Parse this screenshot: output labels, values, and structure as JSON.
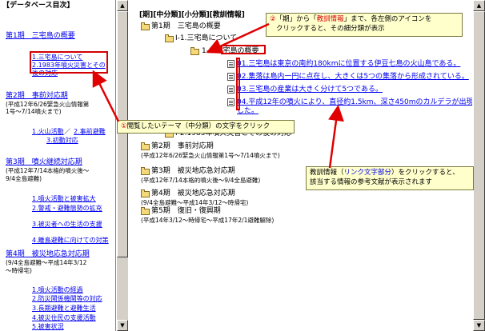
{
  "left": {
    "title": "【データベース目次】",
    "periods": [
      {
        "title": "第1期　三宅島の概要",
        "links": [
          "1.三宅島について",
          "2.1983年噴火災害とその後の対応"
        ]
      },
      {
        "title": "第2期　事前対応期",
        "note": [
          "(平成12年6/26緊急火山情報第",
          "1号〜7/14噴火まで)"
        ],
        "links": [
          "1.火山活動",
          "2.事前避難",
          "3.初動対応"
        ]
      },
      {
        "title": "第3期　噴火継続対応期",
        "note": [
          "(平成12年7/14本格的噴火後〜",
          "9/4全島避難)"
        ],
        "links": [
          "1.噴火活動と被害拡大",
          "2.警戒・避難態勢の拡充",
          "3.被災者への生活の支援",
          "4.離島避難に向けての対策"
        ]
      },
      {
        "title": "第4期　被災地応急対応期",
        "note": [
          "(9/4全島避難〜平成14年3/12",
          "〜時帰宅)"
        ],
        "links": [
          "1.噴火活動の経過",
          "2.防災関係機関等の対応",
          "3.長期避難と避難生活",
          "4.被災住民の支援活動",
          "5.被害状況"
        ]
      }
    ]
  },
  "right": {
    "header": "[期][中分類][小分類][教訓情報]",
    "tree": [
      "第1期　三宅島の概要",
      "I-1.三宅島について",
      "1-1.三宅島の概要",
      "01.三宅島は東京の南約180kmに位置する伊豆七島の火山島である。",
      "02.集落は島内一円に点在し、大きくは5つの集落から形成されている。",
      "03.三宅島の産業は大きく分けて5つである。",
      "04.平成12年の噴火により、直径約1.5km、深さ450mのカルデラが出現した。",
      "I-2.1983年噴火災害とその後の対応",
      "第2期　事前対応期",
      "(平成12年6/26緊急火山情報第1号〜7/14噴火まで)",
      "第3期　被災地応急対応期",
      "(平成12年7/14本格的噴火後〜9/4全島避難)",
      "第4期　被災地応急対応期",
      "(9/4全島避難〜平成14年3/12〜時帰宅)",
      "第5期　復旧・復興期",
      "(平成14年3/12〜時帰宅〜平成17年2/1避難解除)"
    ]
  },
  "callouts": {
    "c1": {
      "num": "①",
      "text": "閲覧したいテーマ（中分類）の文字をクリック"
    },
    "c2": {
      "num": "②",
      "pre": "「期」から「",
      "em": "教訓情報",
      "post": "」まで、各左側のアイコンを",
      "line2": "クリックすると、その細分類が表示"
    },
    "c3": {
      "pre": "教訓情報（",
      "em": "リンク文字部分",
      "post": "）をクリックすると、",
      "line2": "該当する情報の参考文献が表示されます"
    }
  },
  "colors": {
    "accent": "#d40000",
    "link": "#0000ee",
    "callout_bg": "#ffffcc"
  }
}
